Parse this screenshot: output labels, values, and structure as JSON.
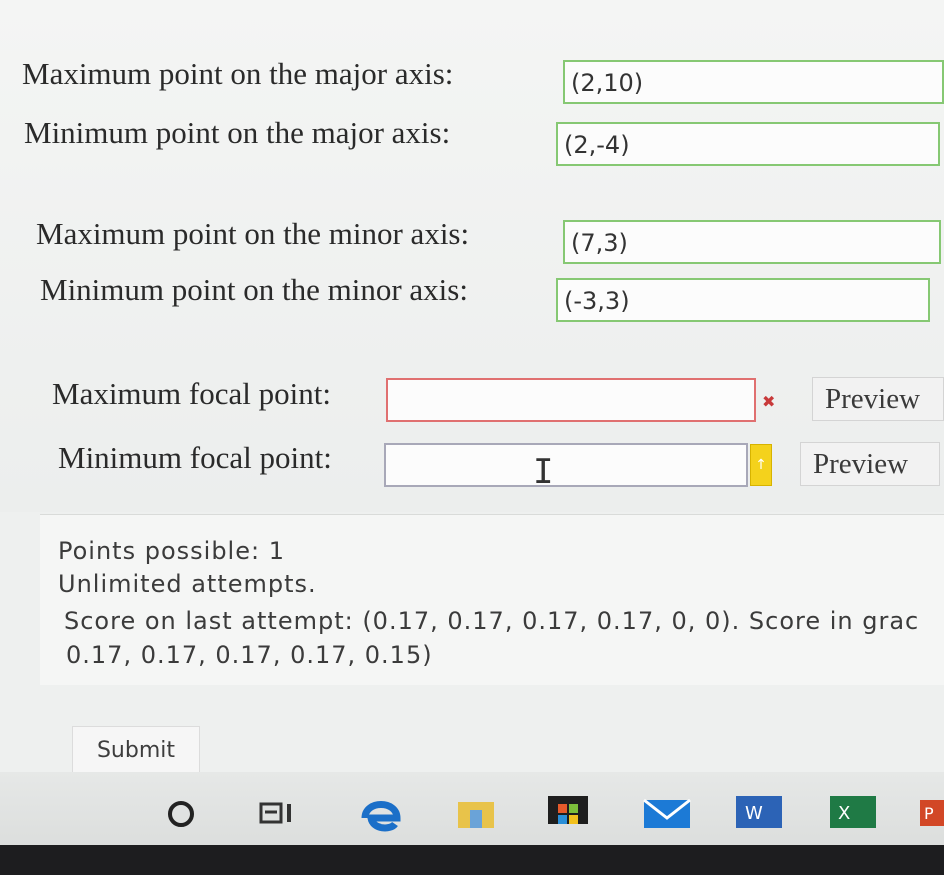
{
  "fields": [
    {
      "label": "Maximum point on the major axis:",
      "value": "(2,10)"
    },
    {
      "label": "Minimum point on the major axis:",
      "value": "(2,-4)"
    },
    {
      "label": "Maximum point on the minor axis:",
      "value": "(7,3)"
    },
    {
      "label": "Minimum point on the minor axis:",
      "value": "(-3,3)"
    },
    {
      "label": "Maximum focal point:",
      "value": ""
    },
    {
      "label": "Minimum focal point:",
      "value": ""
    }
  ],
  "preview_label": "Preview",
  "info": {
    "points": "Points possible: 1",
    "attempts": "Unlimited attempts.",
    "score_line1": "Score on last attempt: (0.17, 0.17, 0.17, 0.17, 0, 0). Score in grac",
    "score_line2": "0.17, 0.17, 0.17, 0.17, 0.15)"
  },
  "submit_label": "Submit",
  "colors": {
    "correct_border": "#86c873",
    "error_border": "#e07070",
    "warning": "#f4d21c"
  }
}
